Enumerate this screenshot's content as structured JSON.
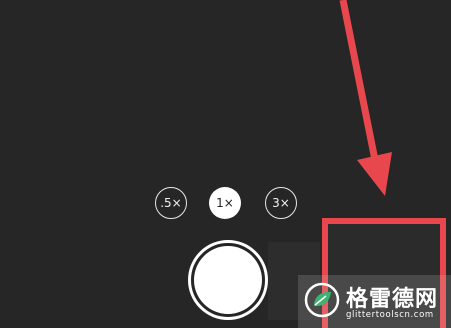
{
  "camera": {
    "zoom_options": [
      {
        "label": ".5×",
        "selected": false
      },
      {
        "label": "1×",
        "selected": true
      },
      {
        "label": "3×",
        "selected": false
      }
    ],
    "shutter_icon": "shutter-circle"
  },
  "annotation": {
    "arrow_color": "#e8474d",
    "box_color": "#e8474d"
  },
  "watermark": {
    "title": "格雷德网",
    "url": "glittertoolscn.com",
    "logo_icon": "g-leaf-logo",
    "logo_color": "#3cb371"
  },
  "colors": {
    "background": "#262626",
    "active_zoom_bg": "#ffffff"
  }
}
